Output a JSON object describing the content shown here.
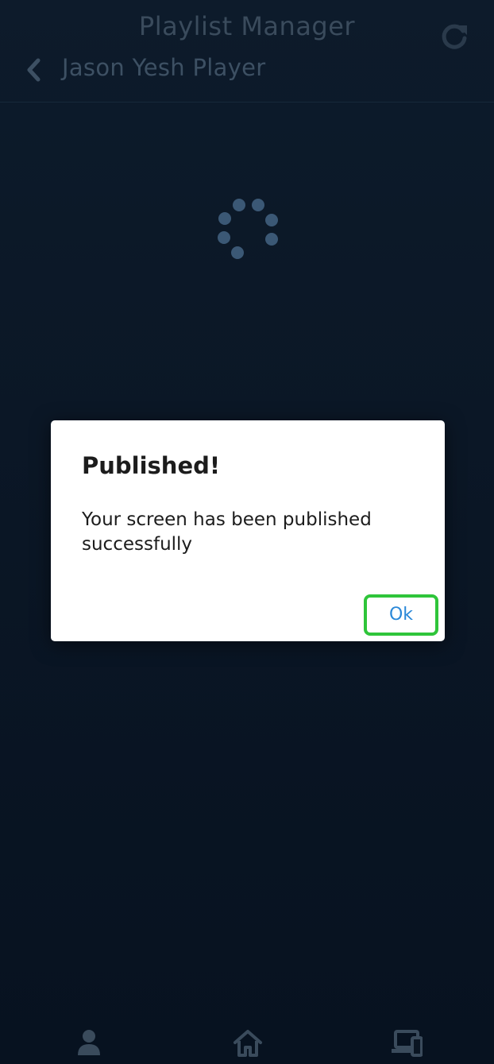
{
  "header": {
    "app_title": "Playlist Manager",
    "page_title": "Jason Yesh Player",
    "refresh_icon": "refresh-icon",
    "back_icon": "chevron-left-icon"
  },
  "main": {
    "loading_icon": "spinner-icon"
  },
  "dialog": {
    "title": "Published!",
    "message": "Your screen has been published successfully",
    "ok_label": "Ok"
  },
  "tabbar": {
    "items": [
      {
        "icon": "user-icon"
      },
      {
        "icon": "home-icon"
      },
      {
        "icon": "devices-icon"
      }
    ]
  },
  "colors": {
    "background": "#0b1726",
    "header_text": "#3a4b5c",
    "dialog_bg": "#ffffff",
    "ok_text": "#2a88d8",
    "highlight": "#2fc53a"
  }
}
